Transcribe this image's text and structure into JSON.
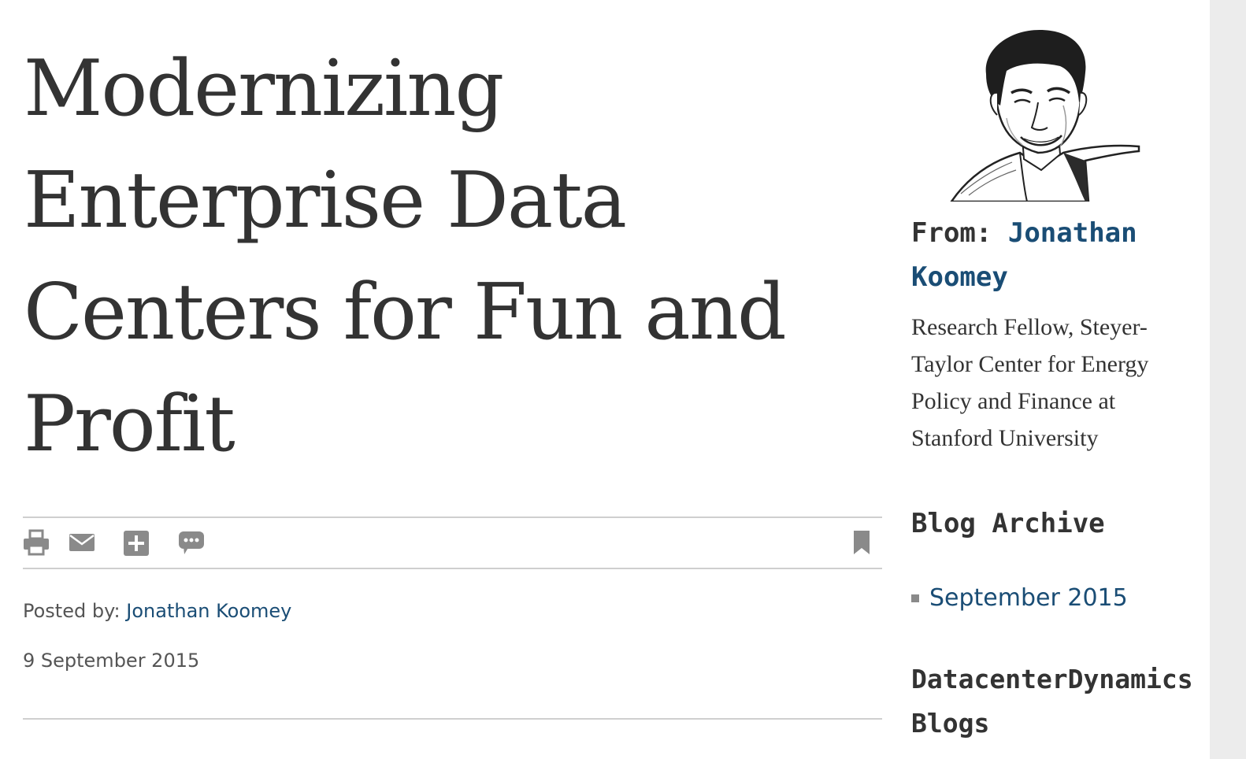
{
  "article": {
    "title": "Modernizing Enterprise Data Centers for Fun and Profit",
    "posted_by_label": "Posted by:",
    "author": "Jonathan Koomey",
    "date": "9 September 2015"
  },
  "toolbar": {
    "icons": [
      "print-icon",
      "mail-icon",
      "add-icon",
      "comment-icon",
      "bookmark-icon"
    ]
  },
  "sidebar": {
    "from_label": "From:",
    "author_name": "Jonathan Koomey",
    "author_bio": "Research Fellow, Steyer-Taylor Center for Energy Policy and Finance at Stanford University",
    "archive_heading": "Blog Archive",
    "archive_items": [
      "September 2015"
    ],
    "blogs_heading": "DatacenterDynamics Blogs"
  },
  "colors": {
    "link": "#1a4d75",
    "text": "#333333",
    "muted": "#555555",
    "icon": "#8a8a8a",
    "rule": "#cfcfcf"
  }
}
